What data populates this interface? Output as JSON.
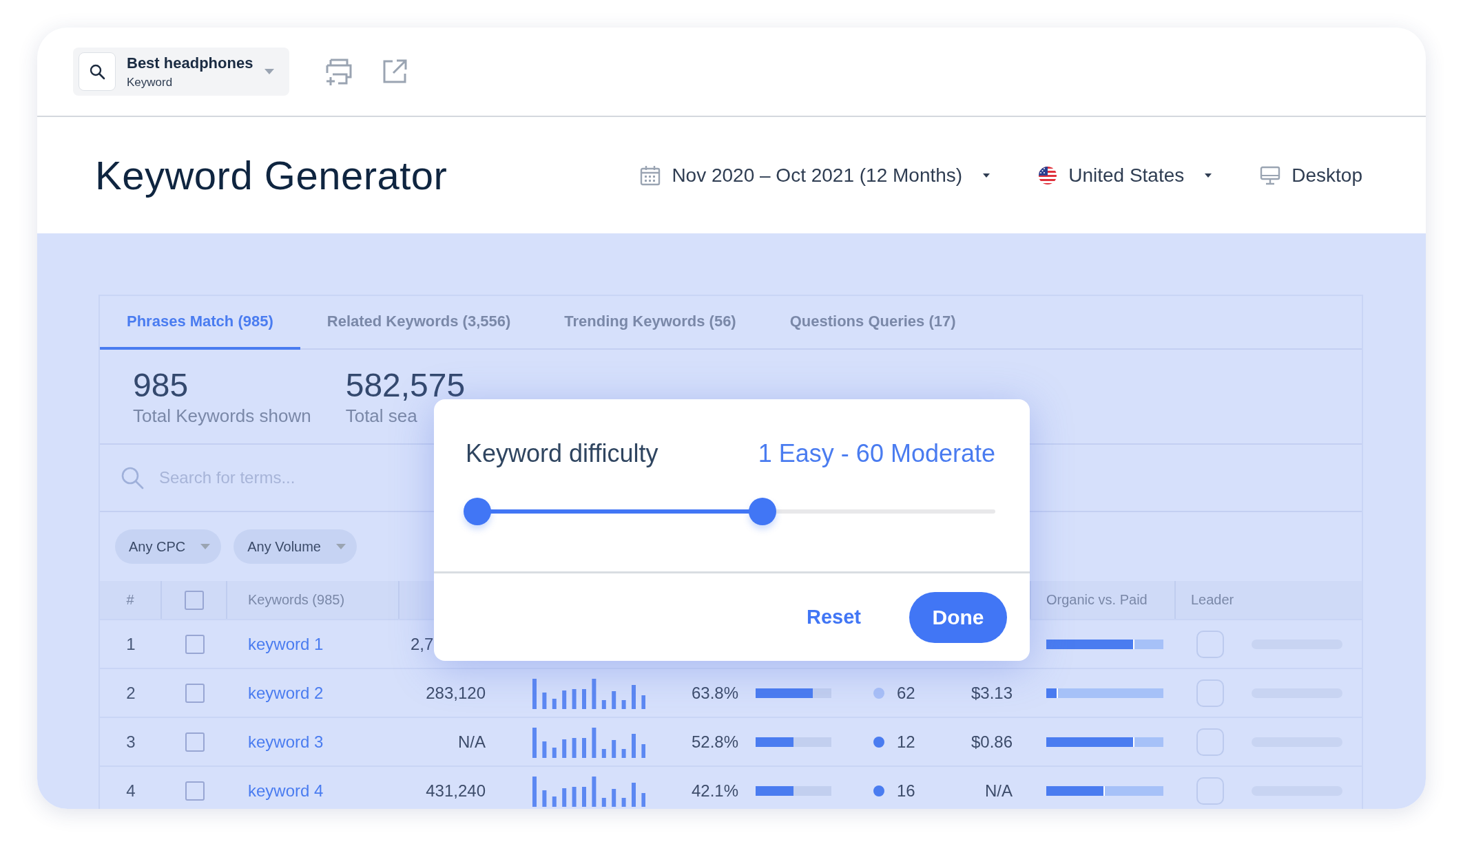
{
  "toolbar": {
    "search": {
      "value": "Best headphones",
      "type_label": "Keyword"
    }
  },
  "header": {
    "title": "Keyword Generator",
    "date_range": "Nov 2020 – Oct 2021 (12 Months)",
    "country": "United States",
    "device": "Desktop"
  },
  "tabs": [
    {
      "label": "Phrases Match (985)",
      "selected": true
    },
    {
      "label": "Related Keywords (3,556)",
      "selected": false
    },
    {
      "label": "Trending Keywords (56)",
      "selected": false
    },
    {
      "label": "Questions Queries (17)",
      "selected": false
    }
  ],
  "stats": [
    {
      "value": "985",
      "label": "Total Keywords shown"
    },
    {
      "value": "582,575",
      "label": "Total sea"
    }
  ],
  "search": {
    "placeholder": "Search for terms..."
  },
  "filters": [
    {
      "label": "Any CPC"
    },
    {
      "label": "Any Volume"
    }
  ],
  "table": {
    "columns": [
      {
        "kind": "number",
        "label": "#"
      },
      {
        "kind": "select",
        "checked": false
      },
      {
        "kind": "keyword",
        "label": "Keywords (985)"
      },
      {
        "kind": "organic",
        "label": "Organic vs. Paid"
      },
      {
        "kind": "leader",
        "label": "Leader"
      }
    ],
    "rows": [
      {
        "number": "1",
        "checked": false,
        "keyword": "keyword 1",
        "volume": "2,7",
        "organic_paid": {
          "level": 0.75
        }
      },
      {
        "number": "2",
        "checked": false,
        "keyword": "keyword 2",
        "volume": "283,120",
        "trend": true,
        "kd": "63.8%",
        "kd_bar": {
          "level": 0.75
        },
        "difficulty": "62",
        "color": "#a9c0f7",
        "cpc": "$3.13",
        "organic_paid": {
          "level": 0.1
        }
      },
      {
        "number": "3",
        "checked": false,
        "keyword": "keyword 3",
        "volume": "N/A",
        "trend": true,
        "kd": "52.8%",
        "kd_bar": {
          "level": 0.5
        },
        "difficulty": "12",
        "color": "#4a7cf0",
        "cpc": "$0.86",
        "organic_paid": {
          "level": 0.75
        }
      },
      {
        "number": "4",
        "checked": false,
        "keyword": "keyword 4",
        "volume": "431,240",
        "trend": true,
        "kd": "42.1%",
        "kd_bar": {
          "level": 0.5
        },
        "difficulty": "16",
        "color": "#4a7cf0",
        "cpc": "N/A",
        "organic_paid": {
          "level": 0.5
        }
      }
    ]
  },
  "filter_popup": {
    "title": "Keyword difficulty",
    "range": "1 Easy - 60 Moderate",
    "slider": {
      "thumbs": [
        {
          "level": 0
        },
        {
          "level": 0.55
        }
      ]
    },
    "buttons": [
      {
        "kind": "text",
        "label": "Reset"
      },
      {
        "kind": "primary",
        "label": "Done"
      }
    ]
  }
}
